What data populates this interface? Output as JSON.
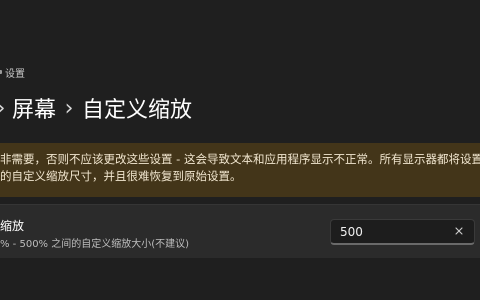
{
  "window": {
    "title": "设置"
  },
  "breadcrumb": {
    "items": [
      "屏幕",
      "自定义缩放"
    ],
    "separator": "›"
  },
  "warning": {
    "line1": "非需要，否则不应该更改这些设置 - 这会导致文本和应用程序显示不正常。所有显示器都将设置",
    "line2": "的自定义缩放尺寸，并且很难恢复到原始设置。"
  },
  "setting": {
    "title": "缩放",
    "description": "% - 500% 之间的自定义缩放大小(不建议)",
    "input_value": "500",
    "clear_icon": "close-icon"
  },
  "colors": {
    "background": "#1f1f1f",
    "warning_bg": "#433519",
    "card_bg": "#2b2b2b"
  }
}
